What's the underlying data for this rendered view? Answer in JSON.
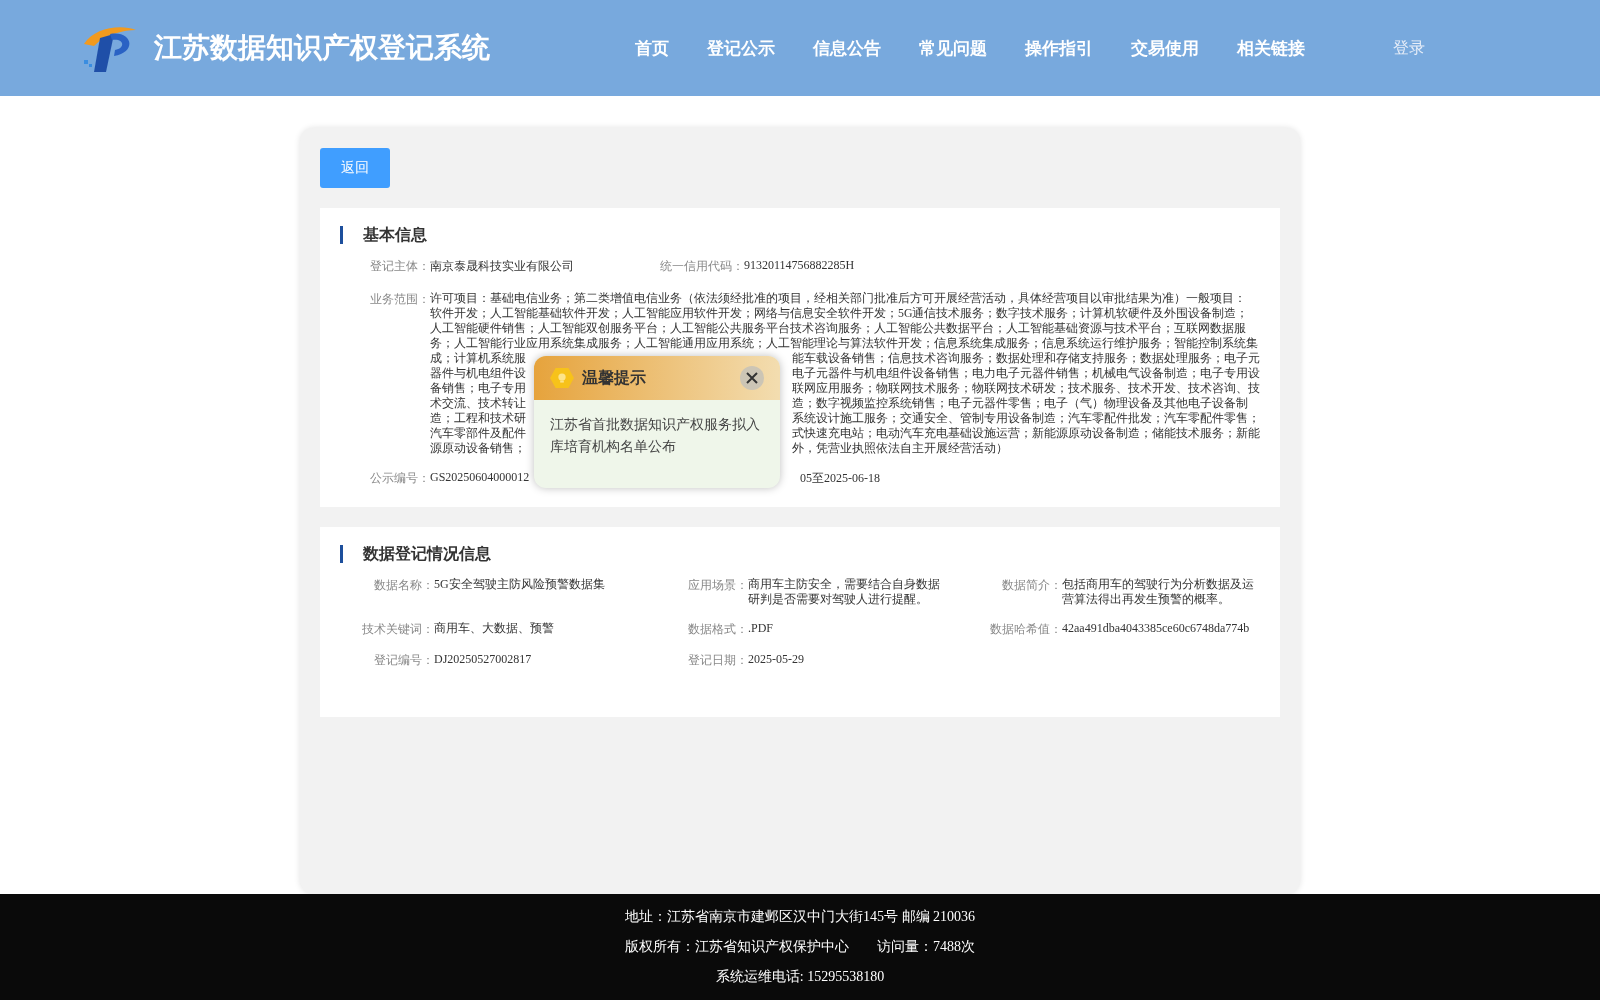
{
  "header": {
    "title": "江苏数据知识产权登记系统",
    "nav": [
      {
        "label": "首页",
        "selected": false
      },
      {
        "label": "登记公示",
        "selected": false
      },
      {
        "label": "信息公告",
        "selected": false
      },
      {
        "label": "常见问题",
        "selected": false
      },
      {
        "label": "操作指引",
        "selected": false
      },
      {
        "label": "交易使用",
        "selected": false
      },
      {
        "label": "相关链接",
        "selected": false
      }
    ],
    "login": "登录"
  },
  "back_button": "返回",
  "basic_info": {
    "title": "基本信息",
    "subject": {
      "label": "登记主体：",
      "value": "南京泰晟科技实业有限公司"
    },
    "credit_code": {
      "label": "统一信用代码：",
      "value": "91320114756882285H"
    },
    "scope": {
      "label": "业务范围：",
      "lines": [
        {
          "text": "许可项目：基础电信业务；第二类增值电信业务（依法须经批准的项目，经相关部门批准后方可开展经营活动，具体经营项目以审批结果为准）一般项目："
        },
        {
          "text": "软件开发；人工智能基础软件开发；人工智能应用软件开发；网络与信息安全软件开发；5G通信技术服务；数字技术服务；计算机软硬件及外围设备制造；"
        },
        {
          "text": "人工智能硬件销售；人工智能双创服务平台；人工智能公共服务平台技术咨询服务；人工智能公共数据平台；人工智能基础资源与技术平台；互联网数据服"
        },
        {
          "text": "务；人工智能行业应用系统集成服务；人工智能通用应用系统；人工智能理论与算法软件开发；信息系统集成服务；信息系统运行维护服务；智能控制系统集"
        },
        {
          "left": "成；计算机系统服",
          "right": "能车载设备销售；信息技术咨询服务；数据处理和存储支持服务；数据处理服务；电子元"
        },
        {
          "left": "器件与机电组件设",
          "right": "电子元器件与机电组件设备销售；电力电子元器件销售；机械电气设备制造；电子专用设"
        },
        {
          "left": "备销售；电子专用",
          "right": "联网应用服务；物联网技术服务；物联网技术研发；技术服务、技术开发、技术咨询、技"
        },
        {
          "left": "术交流、技术转让",
          "right": "造；数字视频监控系统销售；电子元器件零售；电子（气）物理设备及其他电子设备制"
        },
        {
          "left": "造；工程和技术研",
          "right": "系统设计施工服务；交通安全、管制专用设备制造；汽车零配件批发；汽车零配件零售；"
        },
        {
          "left": "汽车零部件及配件",
          "right": "式快速充电站；电动汽车充电基础设施运营；新能源原动设备制造；储能技术服务；新能"
        },
        {
          "left": "源原动设备销售；",
          "right": "外，凭营业执照依法自主开展经营活动）"
        }
      ]
    },
    "notice_no": {
      "label": "公示编号：",
      "value": "GS20250604000012"
    },
    "notice_time_tail": "05至2025-06-18"
  },
  "data_info": {
    "title": "数据登记情况信息",
    "fields": [
      {
        "label": "数据名称：",
        "value": "5G安全驾驶主防风险预警数据集"
      },
      {
        "label": "应用场景：",
        "value": "商用车主防安全，需要结合自身数据研判是否需要对驾驶人进行提醒。"
      },
      {
        "label": "数据简介：",
        "value": "包括商用车的驾驶行为分析数据及运营算法得出再发生预警的概率。"
      },
      {
        "label": "技术关键词：",
        "value": "商用车、大数据、预警"
      },
      {
        "label": "数据格式：",
        "value": ".PDF"
      },
      {
        "label": "数据哈希值：",
        "value": "42aa491dba4043385ce60c6748da774b"
      },
      {
        "label": "登记编号：",
        "value": "DJ20250527002817"
      },
      {
        "label": "登记日期：",
        "value": "2025-05-29"
      }
    ]
  },
  "popup": {
    "title": "温馨提示",
    "message": "江苏省首批数据知识产权服务拟入库培育机构名单公布"
  },
  "footer": {
    "lines": [
      "地址：江苏省南京市建邺区汉中门大街145号 邮编 210036",
      "版权所有：江苏省知识产权保护中心　　访问量：7488次",
      "系统运维电话: 15295538180"
    ]
  }
}
